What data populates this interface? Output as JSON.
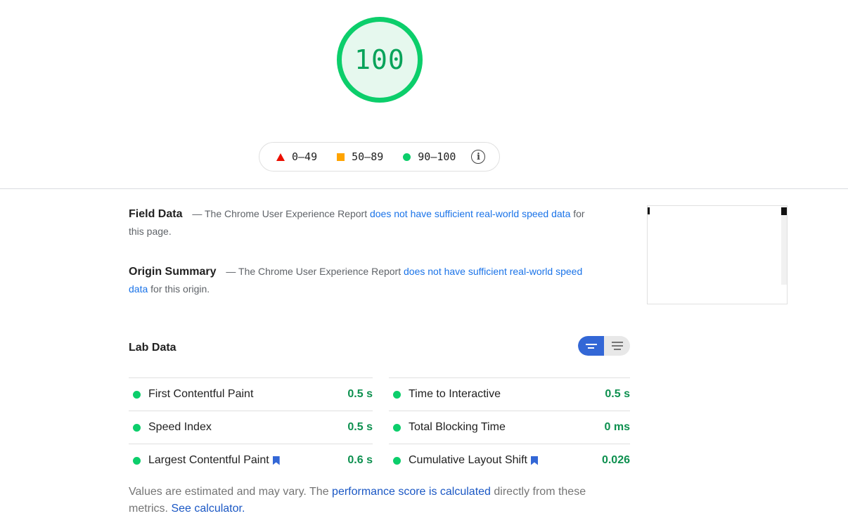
{
  "gauge": {
    "score": "100",
    "score_value": 100,
    "color": "#0cce6b"
  },
  "legend": {
    "fail": "0–49",
    "average": "50–89",
    "pass": "90–100",
    "colors": {
      "fail": "#eb0f00",
      "average": "#ffa400",
      "pass": "#0cce6b"
    }
  },
  "field_data": {
    "title": "Field Data",
    "prefix": "— The Chrome User Experience Report",
    "link": "does not have sufficient real-world speed data",
    "suffix": "for this page."
  },
  "origin_summary": {
    "title": "Origin Summary",
    "prefix": "— The Chrome User Experience Report",
    "link": "does not have sufficient real-world speed data",
    "suffix": "for this origin."
  },
  "lab_data": {
    "title": "Lab Data",
    "view_toggle": {
      "selected": "compact"
    },
    "left_metrics": [
      {
        "name": "First Contentful Paint",
        "value": "0.5 s"
      },
      {
        "name": "Speed Index",
        "value": "0.5 s"
      },
      {
        "name": "Largest Contentful Paint",
        "value": "0.6 s"
      }
    ],
    "right_metrics": [
      {
        "name": "Time to Interactive",
        "value": "0.5 s"
      },
      {
        "name": "Total Blocking Time",
        "value": "0 ms"
      },
      {
        "name": "Cumulative Layout Shift",
        "value": "0.026"
      }
    ]
  },
  "footer": {
    "prefix": "Values are estimated and may vary. The",
    "link1": "performance score is calculated",
    "middle": "directly from these metrics.",
    "link2": "See calculator."
  }
}
